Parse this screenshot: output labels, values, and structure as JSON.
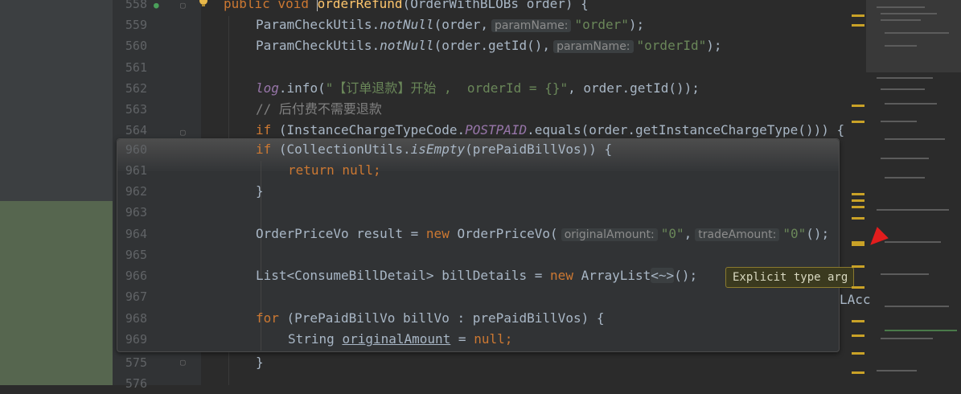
{
  "editor": {
    "lines": [
      {
        "num": "558",
        "top": 0
      },
      {
        "num": "559",
        "top": 0
      },
      {
        "num": "560",
        "top": 0
      },
      {
        "num": "561",
        "top": 0
      },
      {
        "num": "562",
        "top": 0
      },
      {
        "num": "563",
        "top": 0
      },
      {
        "num": "564",
        "top": 0
      }
    ],
    "code_558_kw": "public void ",
    "code_558_fn": "orderRefund",
    "code_558_rest": "(OrderWithBLOBs order) {",
    "code_559_a": "ParamCheckUtils.",
    "code_559_b": "notNull",
    "code_559_c": "(order,",
    "code_559_hint": "paramName:",
    "code_559_str": "\"order\"",
    "code_559_end": ");",
    "code_560_a": "ParamCheckUtils.",
    "code_560_b": "notNull",
    "code_560_c": "(order.getId(),",
    "code_560_hint": "paramName:",
    "code_560_str": "\"orderId\"",
    "code_560_end": ");",
    "code_562_log": "log",
    "code_562_a": ".info(",
    "code_562_str": "\"【订单退款】开始 ,  orderId = {}\"",
    "code_562_end": ", order.getId());",
    "code_563_cm": "// 后付费不需要退款",
    "code_564_kw": "if ",
    "code_564_a": "(InstanceChargeTypeCode.",
    "code_564_const": "POSTPAID",
    "code_564_end": ".equals(order.getInstanceChargeType())) {",
    "code_960_kw": "if ",
    "code_960_a": "(CollectionUtils.",
    "code_960_it": "isEmpty",
    "code_960_end": "(prePaidBillVos)) {",
    "code_961_kw": "return null",
    "code_961_end": ";",
    "code_962": "}",
    "code_964_a": "OrderPriceVo result = ",
    "code_964_kw": "new ",
    "code_964_b": "OrderPriceVo(",
    "code_964_hint1": "originalAmount:",
    "code_964_str1": "\"0\"",
    "code_964_comma": ",",
    "code_964_hint2": "tradeAmount:",
    "code_964_str2": "\"0\"",
    "code_964_end": "();",
    "code_966_a": "List<ConsumeBillDetail> billDetails = ",
    "code_966_kw": "new ",
    "code_966_b": "ArrayList",
    "code_966_diamond": "<~>",
    "code_966_end": "();",
    "code_968_kw": "for ",
    "code_968_end": "(PrePaidBillVo billVo : prePaidBillVos) {",
    "code_969_a": "String ",
    "code_969_var": "originalAmount",
    "code_969_b": " = ",
    "code_969_kw": "null",
    "code_969_end": ";",
    "code_575": "}",
    "overflow_text": "LAcc"
  },
  "line_numbers": {
    "l558": "558",
    "l559": "559",
    "l560": "560",
    "l561": "561",
    "l562": "562",
    "l563": "563",
    "l564": "564",
    "l960": "960",
    "l961": "961",
    "l962": "962",
    "l963": "963",
    "l964": "964",
    "l965": "965",
    "l966": "966",
    "l967": "967",
    "l968": "968",
    "l969": "969",
    "l575": "575",
    "l576": "576"
  },
  "tooltip": {
    "text": "Explicit type arg"
  },
  "colors": {
    "keyword": "#cc7832",
    "function": "#ffc66d",
    "string": "#6a8759",
    "constant": "#9876aa",
    "comment": "#808080",
    "text": "#a9b7c6",
    "marker": "#c9a227",
    "arrow": "#e21d1d"
  }
}
